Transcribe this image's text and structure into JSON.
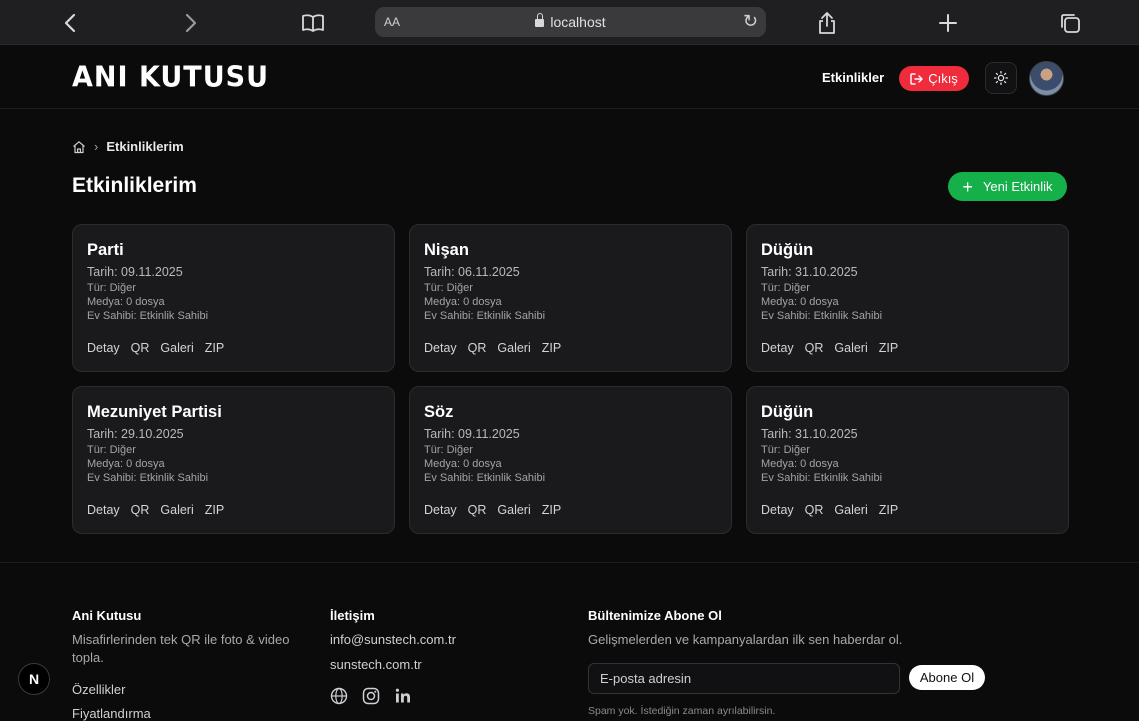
{
  "browser": {
    "url": "localhost",
    "text_size_label": "AA"
  },
  "header": {
    "logo": "ANI KUTUSU",
    "nav_events": "Etkinlikler",
    "logout": "Çıkış"
  },
  "breadcrumb": {
    "current": "Etkinliklerim"
  },
  "page": {
    "title": "Etkinliklerim",
    "new_button": "Yeni Etkinlik"
  },
  "events": [
    {
      "title": "Parti",
      "date": "Tarih: 09.11.2025",
      "type": "Tür: Diğer",
      "media": "Medya: 0 dosya",
      "host": "Ev Sahibi: Etkinlik Sahibi"
    },
    {
      "title": "Nişan",
      "date": "Tarih: 06.11.2025",
      "type": "Tür: Diğer",
      "media": "Medya: 0 dosya",
      "host": "Ev Sahibi: Etkinlik Sahibi"
    },
    {
      "title": "Düğün",
      "date": "Tarih: 31.10.2025",
      "type": "Tür: Diğer",
      "media": "Medya: 0 dosya",
      "host": "Ev Sahibi: Etkinlik Sahibi"
    },
    {
      "title": "Mezuniyet Partisi",
      "date": "Tarih: 29.10.2025",
      "type": "Tür: Diğer",
      "media": "Medya: 0 dosya",
      "host": "Ev Sahibi: Etkinlik Sahibi"
    },
    {
      "title": "Söz",
      "date": "Tarih: 09.11.2025",
      "type": "Tür: Diğer",
      "media": "Medya: 0 dosya",
      "host": "Ev Sahibi: Etkinlik Sahibi"
    },
    {
      "title": "Düğün",
      "date": "Tarih: 31.10.2025",
      "type": "Tür: Diğer",
      "media": "Medya: 0 dosya",
      "host": "Ev Sahibi: Etkinlik Sahibi"
    }
  ],
  "card_actions": {
    "detail": "Detay",
    "qr": "QR",
    "gallery": "Galeri",
    "zip": "ZIP"
  },
  "footer": {
    "brand_title": "Ani Kutusu",
    "brand_desc": "Misafirlerinden tek QR ile foto & video topla.",
    "features": "Özellikler",
    "pricing_partial": "Fiyatlandırma",
    "contact_title": "İletişim",
    "email": "info@sunstech.com.tr",
    "website": "sunstech.com.tr",
    "newsletter_title": "Bültenimize Abone Ol",
    "newsletter_desc": "Gelişmelerden ve kampanyalardan ilk sen haberdar ol.",
    "email_placeholder": "E-posta adresin",
    "subscribe": "Abone Ol",
    "spam_note": "Spam yok. İstediğin zaman ayrılabilirsin."
  },
  "dev_badge": "N",
  "colors": {
    "background": "#0b0b0c",
    "card": "#1a1a1c",
    "logout": "#ef2b3c",
    "new_button": "#16b04a"
  }
}
